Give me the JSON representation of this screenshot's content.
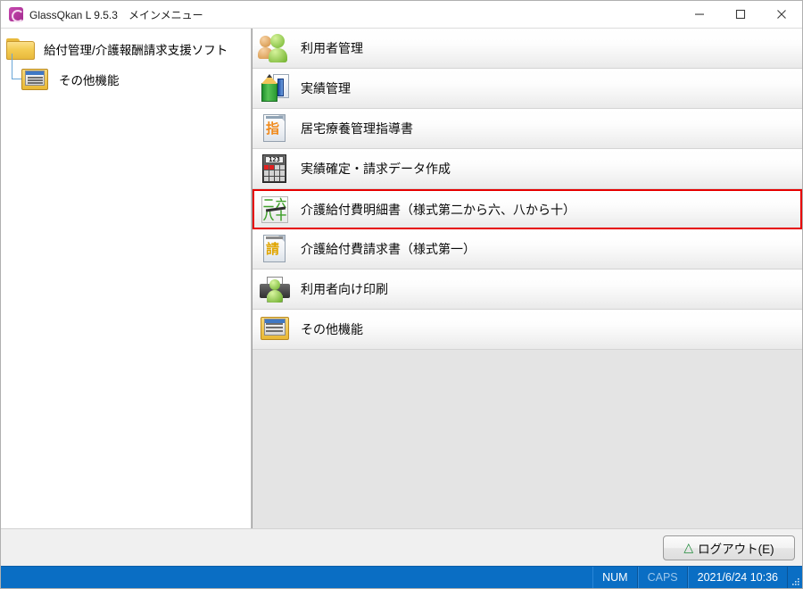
{
  "window": {
    "app_icon": "glassqkan-app-icon",
    "title": "GlassQkan L 9.5.3　メインメニュー",
    "minimize_label": "—",
    "maximize_label": "□",
    "close_label": "✕"
  },
  "tree": {
    "root": {
      "icon": "folder-icon",
      "label": "給付管理/介護報酬請求支援ソフト"
    },
    "child": {
      "icon": "folder-list-icon",
      "label": "その他機能"
    }
  },
  "menu": {
    "selected_index": 4,
    "selection_color": "#e60000",
    "items": [
      {
        "icon": "users-icon",
        "label": "利用者管理"
      },
      {
        "icon": "pencil-document-icon",
        "label": "実績管理"
      },
      {
        "icon": "shi-document-icon",
        "glyph": "指",
        "label": "居宅療養管理指導書"
      },
      {
        "icon": "calculator-icon",
        "display": "123",
        "label": "実績確定・請求データ作成"
      },
      {
        "icon": "forms-numbers-icon",
        "glyphs": [
          "二",
          "六",
          "八",
          "十"
        ],
        "label": "介護給付費明細書（様式第二から六、八から十）"
      },
      {
        "icon": "sei-document-icon",
        "glyph": "請",
        "label": "介護給付費請求書（様式第一）"
      },
      {
        "icon": "printer-person-icon",
        "label": "利用者向け印刷"
      },
      {
        "icon": "folder-list-icon",
        "label": "その他機能"
      }
    ]
  },
  "buttonbar": {
    "logout": {
      "icon": "green-up-arrow-icon",
      "label": "ログアウト(E)",
      "accesskey": "E"
    }
  },
  "statusbar": {
    "background": "#0a6ec4",
    "num": "NUM",
    "caps": "CAPS",
    "datetime": "2021/6/24 10:36",
    "grip": "resize-grip-icon"
  }
}
